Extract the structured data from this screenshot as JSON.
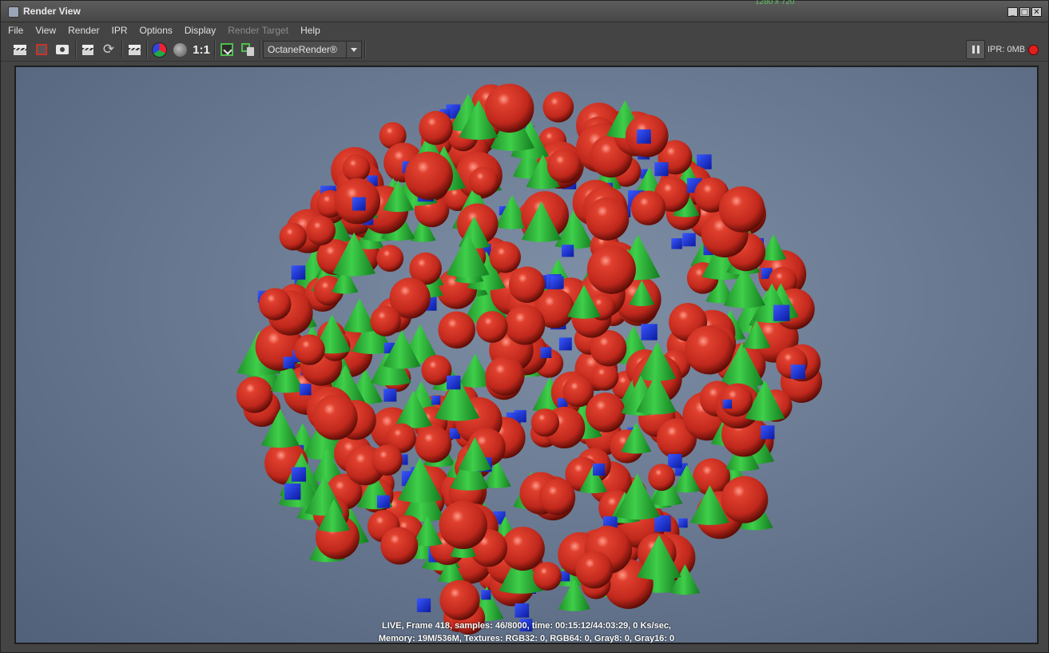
{
  "window": {
    "title": "Render View",
    "resolution_hint": "1280 x 720",
    "controls": {
      "minimize": "_",
      "maximize": "□",
      "close": "✕"
    }
  },
  "menu": {
    "items": [
      {
        "label": "File",
        "enabled": true
      },
      {
        "label": "View",
        "enabled": true
      },
      {
        "label": "Render",
        "enabled": true
      },
      {
        "label": "IPR",
        "enabled": true
      },
      {
        "label": "Options",
        "enabled": true
      },
      {
        "label": "Display",
        "enabled": true
      },
      {
        "label": "Render Target",
        "enabled": false
      },
      {
        "label": "Help",
        "enabled": true
      }
    ]
  },
  "toolbar": {
    "icons": [
      "render-frame-icon",
      "render-region-icon",
      "snapshot-icon",
      "ipr-render-icon",
      "refresh-ipr-icon",
      "render-sequence-icon",
      "rgb-channels-icon",
      "alpha-channel-icon",
      "real-size-icon",
      "keep-image-icon",
      "remove-image-icon"
    ],
    "one_to_one": "1:1",
    "renderer": "OctaneRender®",
    "ipr_memory": "IPR: 0MB",
    "pause_icon": "pause-icon",
    "record_icon": "record-icon"
  },
  "colors": {
    "sphere": "#c0281c",
    "cone": "#3fcf4a",
    "cube": "#1a30d8",
    "background": "#6f7f97"
  },
  "render_info": {
    "line1": "LIVE, Frame 418, samples: 46/8000, time: 00:15:12/44:03:29, 0 Ks/sec,",
    "line2": "Memory: 19M/536M, Textures: RGB32: 0, RGB64: 0, Gray8: 0, Gray16: 0"
  }
}
